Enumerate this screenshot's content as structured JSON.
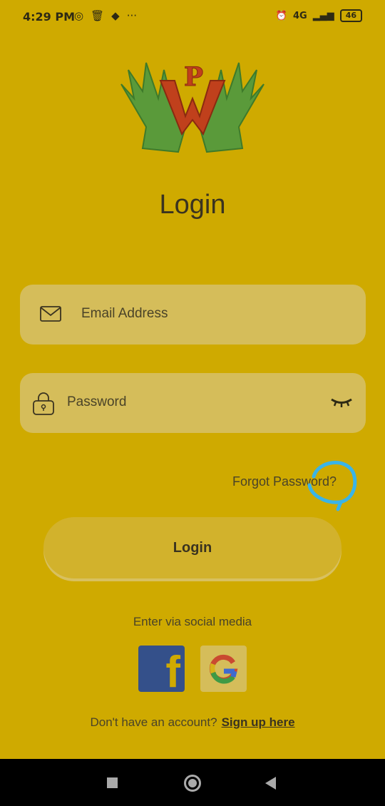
{
  "status_bar": {
    "time": "4:29 PM",
    "network": "4G",
    "battery": "46"
  },
  "logo": {
    "letters": "WP"
  },
  "title": "Login",
  "email": {
    "placeholder": "Email Address"
  },
  "password": {
    "placeholder": "Password"
  },
  "forgot_password": "Forgot Password?",
  "login_button": "Login",
  "social_label": "Enter via social media",
  "facebook_glyph": "f",
  "signup": {
    "prompt": "Don't have an account?",
    "link": "Sign up here"
  },
  "colors": {
    "background": "#cfaa00",
    "field": "#d5bd5a",
    "annotation": "#3ab4e8"
  }
}
